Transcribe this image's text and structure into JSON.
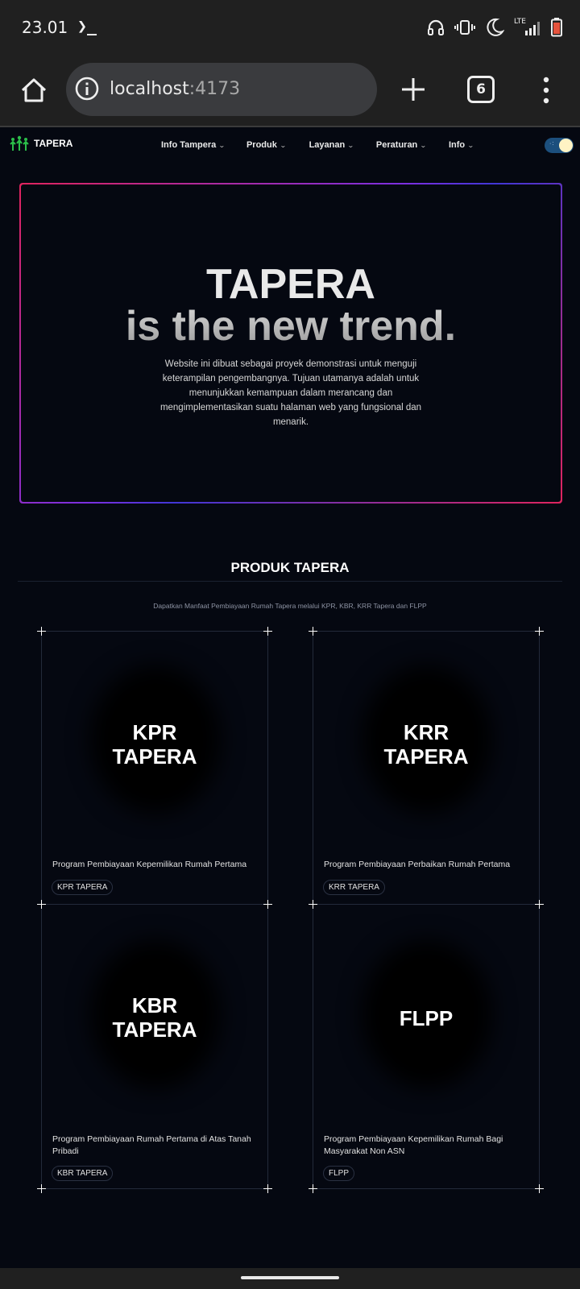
{
  "status_bar": {
    "time": "23.01",
    "terminal_glyph": "❯_",
    "network_label": "LTE",
    "icons": [
      "headphones-icon",
      "vibrate-icon",
      "do-not-disturb-moon-icon",
      "lte-signal-icon",
      "battery-low-icon"
    ]
  },
  "browser": {
    "url_host": "localhost",
    "url_port": ":4173",
    "tab_count": "6",
    "icons": [
      "home-icon",
      "info-icon",
      "new-tab-plus-icon",
      "tab-switcher-icon",
      "overflow-menu-icon"
    ]
  },
  "site": {
    "logo_text": "TAPERA",
    "nav": [
      {
        "label": "Info Tampera"
      },
      {
        "label": "Produk"
      },
      {
        "label": "Layanan"
      },
      {
        "label": "Peraturan"
      },
      {
        "label": "Info"
      }
    ],
    "theme_toggle": "dark"
  },
  "hero": {
    "title": "TAPERA",
    "subtitle": "is the new trend.",
    "description": "Website ini dibuat sebagai proyek demonstrasi untuk menguji keterampilan pengembangnya. Tujuan utamanya adalah untuk menunjukkan kemampuan dalam merancang dan mengimplementasikan suatu halaman web yang fungsional dan menarik."
  },
  "produk": {
    "title": "PRODUK TAPERA",
    "description": "Dapatkan Manfaat Pembiayaan Rumah Tapera melalui KPR, KBR, KRR Tapera dan FLPP",
    "cards": [
      {
        "name": "KPR\nTAPERA",
        "desc": "Program Pembiayaan Kepemilikan Rumah Pertama",
        "tag": "KPR TAPERA"
      },
      {
        "name": "KRR\nTAPERA",
        "desc": "Program Pembiayaan Perbaikan Rumah Pertama",
        "tag": "KRR TAPERA"
      },
      {
        "name": "KBR\nTAPERA",
        "desc": "Program Pembiayaan Rumah Pertama di Atas Tanah Pribadi",
        "tag": "KBR TAPERA"
      },
      {
        "name": "FLPP",
        "desc": "Program Pembiayaan Kepemilikan Rumah Bagi Masyarakat Non ASN",
        "tag": "FLPP"
      }
    ]
  },
  "colors": {
    "page_bg": "#050811",
    "chrome_bg": "#202020",
    "hero_gradient": [
      "#e0245e",
      "#7b2fe0",
      "#4136d6"
    ],
    "logo_green": "#2bbf4a",
    "toggle_blue": "#1c4f7d"
  }
}
